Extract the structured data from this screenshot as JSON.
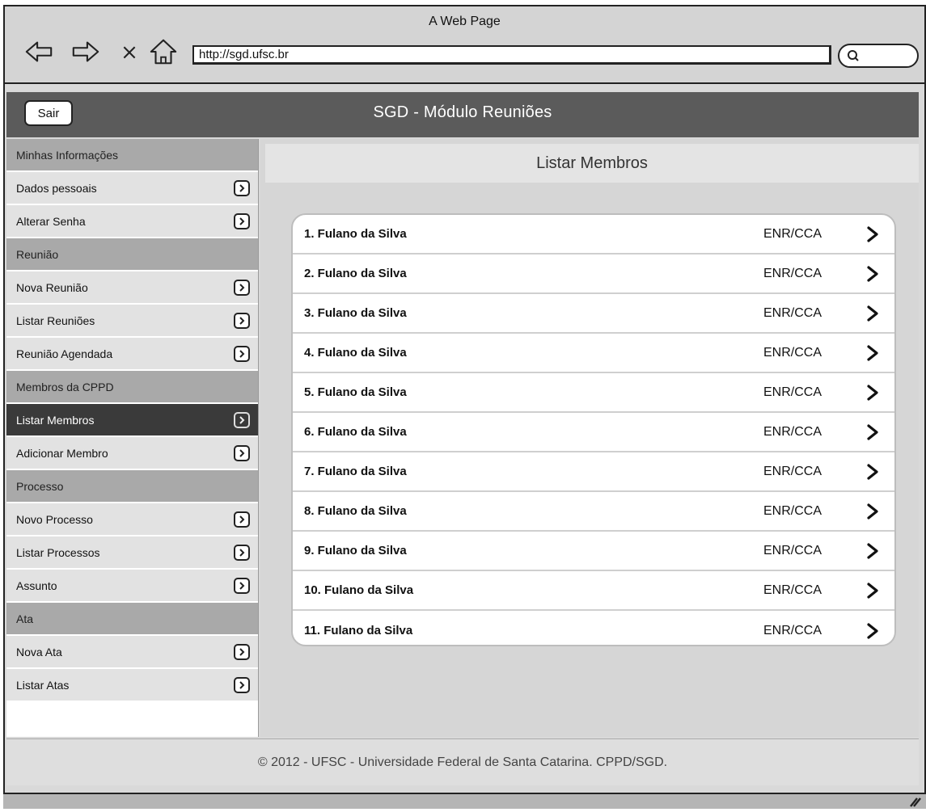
{
  "window": {
    "title": "A Web Page",
    "url": "http://sgd.ufsc.br"
  },
  "header": {
    "title": "SGD - Módulo Reuniões",
    "logout_label": "Sair"
  },
  "sidebar": [
    {
      "type": "section",
      "label": "Minhas Informações"
    },
    {
      "type": "item",
      "label": "Dados pessoais"
    },
    {
      "type": "item",
      "label": "Alterar Senha"
    },
    {
      "type": "section",
      "label": "Reunião"
    },
    {
      "type": "item",
      "label": "Nova Reunião"
    },
    {
      "type": "item",
      "label": "Listar Reuniões"
    },
    {
      "type": "item",
      "label": "Reunião Agendada"
    },
    {
      "type": "section",
      "label": "Membros da CPPD"
    },
    {
      "type": "item",
      "label": "Listar Membros",
      "active": true
    },
    {
      "type": "item",
      "label": "Adicionar Membro"
    },
    {
      "type": "section",
      "label": "Processo"
    },
    {
      "type": "item",
      "label": "Novo Processo"
    },
    {
      "type": "item",
      "label": "Listar Processos"
    },
    {
      "type": "item",
      "label": "Assunto"
    },
    {
      "type": "section",
      "label": "Ata"
    },
    {
      "type": "item",
      "label": "Nova Ata"
    },
    {
      "type": "item",
      "label": "Listar Atas"
    }
  ],
  "main": {
    "title": "Listar Membros",
    "members": [
      {
        "name": "1. Fulano da Silva",
        "dept": "ENR/CCA"
      },
      {
        "name": "2. Fulano da Silva",
        "dept": "ENR/CCA"
      },
      {
        "name": "3. Fulano da Silva",
        "dept": "ENR/CCA"
      },
      {
        "name": "4. Fulano da Silva",
        "dept": "ENR/CCA"
      },
      {
        "name": "5. Fulano da Silva",
        "dept": "ENR/CCA"
      },
      {
        "name": "6. Fulano da Silva",
        "dept": "ENR/CCA"
      },
      {
        "name": "7. Fulano da Silva",
        "dept": "ENR/CCA"
      },
      {
        "name": "8. Fulano da Silva",
        "dept": "ENR/CCA"
      },
      {
        "name": "9. Fulano da Silva",
        "dept": "ENR/CCA"
      },
      {
        "name": "10. Fulano da Silva",
        "dept": "ENR/CCA"
      },
      {
        "name": "11. Fulano da Silva",
        "dept": "ENR/CCA"
      }
    ]
  },
  "footer": {
    "text": "© 2012 - UFSC - Universidade Federal de Santa Catarina. CPPD/SGD."
  },
  "icons": {
    "back": "back-arrow-icon",
    "forward": "forward-arrow-icon",
    "stop": "close-icon",
    "home": "home-icon",
    "search": "search-icon",
    "item_arrow": "chevron-right-icon"
  },
  "colors": {
    "header_bg": "#5b5b5b",
    "section_bg": "#a9a9a9",
    "item_bg": "#e2e2e2",
    "active_item_bg": "#3a3a3a",
    "content_bg": "#d6d6d6"
  }
}
